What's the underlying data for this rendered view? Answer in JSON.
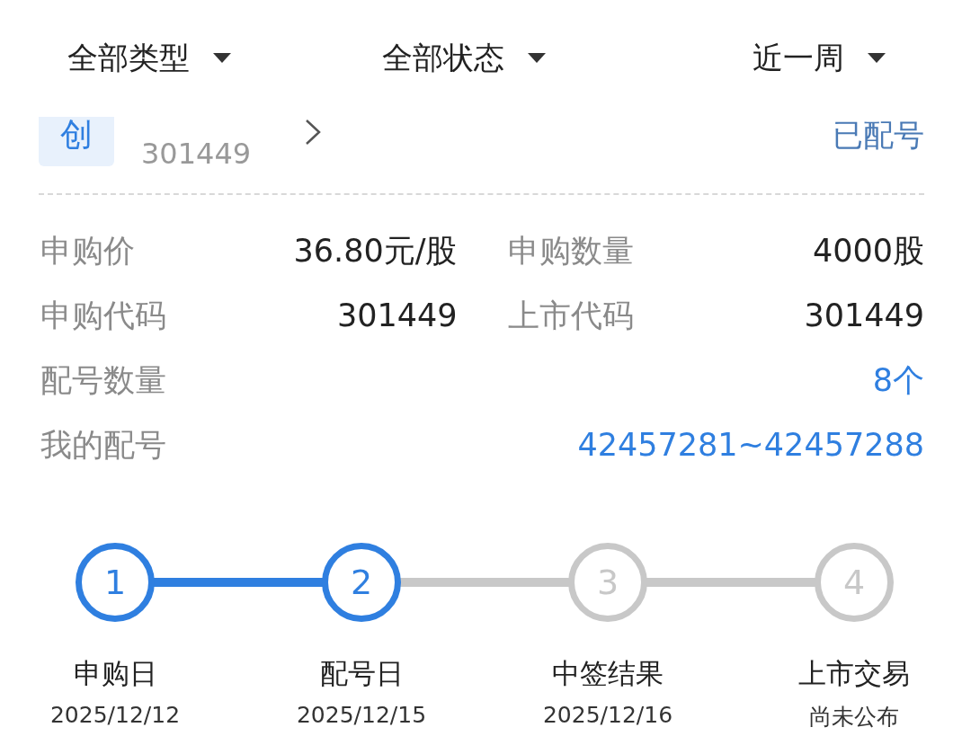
{
  "filters": [
    {
      "label": "全部类型"
    },
    {
      "label": "全部状态"
    },
    {
      "label": "近一周"
    }
  ],
  "card": {
    "badge": "创",
    "code": "301449",
    "status": "已配号"
  },
  "rows": [
    [
      {
        "label": "申购价",
        "value": "36.80元/股",
        "kind": "plain"
      },
      {
        "label": "申购数量",
        "value": "4000股",
        "kind": "plain"
      }
    ],
    [
      {
        "label": "申购代码",
        "value": "301449",
        "kind": "plain"
      },
      {
        "label": "上市代码",
        "value": "301449",
        "kind": "plain"
      }
    ],
    [
      {
        "label": "配号数量",
        "value": "8个",
        "kind": "link"
      }
    ],
    [
      {
        "label": "我的配号",
        "value": "42457281~42457288",
        "kind": "link"
      }
    ]
  ],
  "steps": [
    {
      "number": "1",
      "label": "申购日",
      "date": "2025/12/12",
      "done": true
    },
    {
      "number": "2",
      "label": "配号日",
      "date": "2025/12/15",
      "done": true
    },
    {
      "number": "3",
      "label": "中签结果",
      "date": "2025/12/16",
      "done": false
    },
    {
      "number": "4",
      "label": "上市交易",
      "date": "尚未公布",
      "done": false
    }
  ]
}
